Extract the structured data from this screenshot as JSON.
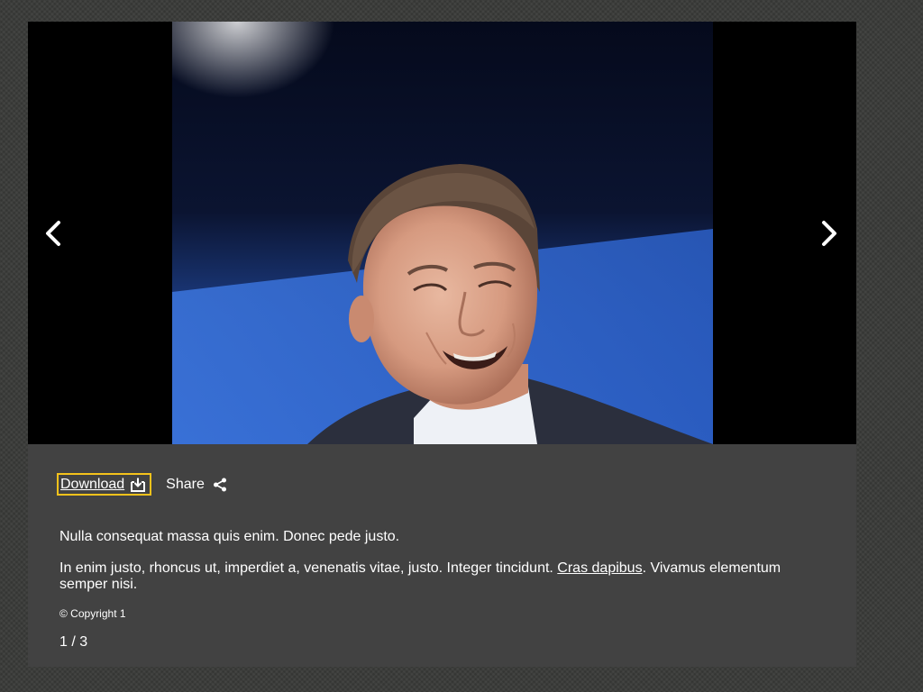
{
  "toolbar": {
    "download_label": "Download",
    "share_label": "Share"
  },
  "caption": {
    "line1": "Nulla consequat massa quis enim. Donec pede justo.",
    "p2_before": "In enim justo, rhoncus ut, imperdiet a, venenatis vitae, justo. Integer tincidunt. ",
    "p2_link": "Cras dapibus",
    "p2_after": ". Vivamus elementum semper nisi."
  },
  "copyright": "© Copyright 1",
  "counter": "1 / 3",
  "icons": {
    "prev": "chevron-left-icon",
    "next": "chevron-right-icon",
    "download": "download-icon",
    "share": "share-icon"
  },
  "colors": {
    "focus_outline": "#f4c21b",
    "panel": "#424242",
    "stage": "#000000"
  }
}
